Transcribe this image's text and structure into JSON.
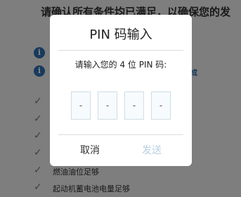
{
  "background": {
    "heading": "请确认所有条件均已满足，以确保您的发",
    "info_tail": "成",
    "info_icon": "i",
    "checks": [
      {
        "label": ""
      },
      {
        "label": ""
      },
      {
        "label": ""
      },
      {
        "label": ""
      },
      {
        "label": "燃油油位足够"
      },
      {
        "label": "起动机蓄电池电量足够"
      }
    ]
  },
  "dialog": {
    "title": "PIN 码输入",
    "prompt": "请输入您的 4 位 PIN 码:",
    "pin_digits": [
      "-",
      "-",
      "-",
      "-"
    ],
    "cancel_label": "取消",
    "send_label": "发送",
    "send_enabled": false
  },
  "colors": {
    "accent": "#2f6fb0",
    "send_disabled": "#b9cfe3",
    "pin_border": "#cfdde6"
  }
}
